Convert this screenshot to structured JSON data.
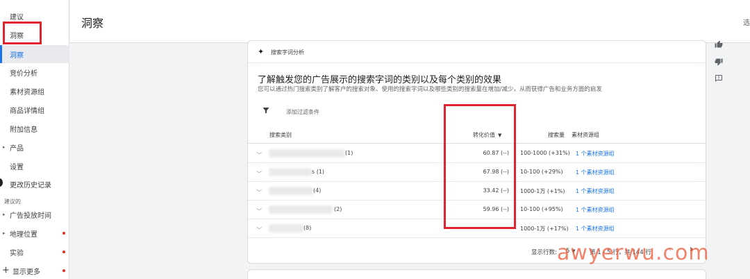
{
  "sidebar": {
    "items": [
      {
        "label": "建议"
      },
      {
        "label": "洞察"
      },
      {
        "label": "洞察"
      },
      {
        "label": "竞价分析"
      },
      {
        "label": "素材资源组"
      },
      {
        "label": "商品详情组"
      },
      {
        "label": "附加信息"
      },
      {
        "label": "产品"
      },
      {
        "label": "设置"
      },
      {
        "label": "更改历史记录"
      }
    ],
    "section_label": "建议的",
    "suggested": [
      {
        "label": "广告投放时间"
      },
      {
        "label": "地理位置"
      },
      {
        "label": "实验"
      },
      {
        "label": "显示更多"
      }
    ]
  },
  "header": {
    "title": "洞察",
    "right_text": "选"
  },
  "card": {
    "top_label": "搜索字词分析",
    "heading": "了解触发您的广告展示的搜索字词的类别以及每个类别的效果",
    "description": "您可以通过热门搜索类别了解客户的搜索对象、使用的搜索字词以及哪些类别的搜索量在增加/减少，从而获得广告和业务方面的启发",
    "filter_label": "添加过滤条件",
    "columns": {
      "category": "搜索类别",
      "conversion_value": "转化价值",
      "search_volume": "搜索量",
      "asset_group": "素材资源组"
    },
    "rows": [
      {
        "category_suffix": "(1)",
        "conversion_value": "60.87 (--)",
        "search_volume": "100-1000 (+31%)",
        "asset_group": "1 个素材资源组"
      },
      {
        "category_suffix": "s (1)",
        "conversion_value": "67.98 (--)",
        "search_volume": "10-100 (+29%)",
        "asset_group": "1 个素材资源组"
      },
      {
        "category_suffix": "(4)",
        "conversion_value": "33.42 (--)",
        "search_volume": "1000-1万 (+1%)",
        "asset_group": "1 个素材资源组"
      },
      {
        "category_suffix": "(2)",
        "conversion_value": "59.96 (--)",
        "search_volume": "10-100 (+95%)",
        "asset_group": "1 个素材资源组"
      },
      {
        "category_suffix": "(8)",
        "conversion_value": "",
        "search_volume": "1000-1万 (+17%)",
        "asset_group": "1 个素材资源组"
      }
    ],
    "pagination": {
      "rows_label": "显示行数:",
      "rows_value": "5",
      "range_text": "第 1 - 5 行，共 144 行"
    }
  },
  "watermark": "awyerwu.com",
  "colors": {
    "accent": "#1a73e8",
    "highlight": "#e0242f",
    "notification_dot": "#d93025"
  }
}
